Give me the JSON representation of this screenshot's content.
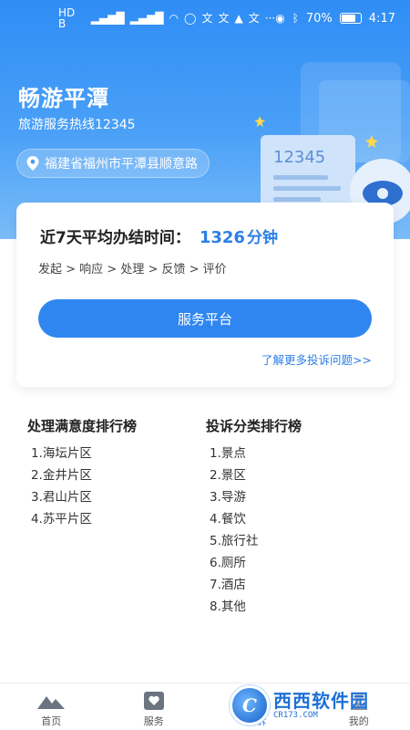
{
  "status_bar": {
    "left_tags": [
      "HD B",
      "HD B"
    ],
    "signal": "4G",
    "battery_percent": "70%",
    "time": "4:17"
  },
  "header": {
    "title": "畅游平潭",
    "subtitle": "旅游服务热线12345",
    "address": "福建省福州市平潭县顺意路",
    "deco_number": "12345"
  },
  "card": {
    "avg_label": "近7天平均办结时间：",
    "avg_value": "1326",
    "avg_unit": "分钟",
    "flow": "发起 > 响应 > 处理 > 反馈 > 评价",
    "service_button": "服务平台",
    "more_link": "了解更多投诉问题>>"
  },
  "rankings": {
    "satisfaction": {
      "title": "处理满意度排行榜",
      "items": [
        "1.海坛片区",
        "2.金井片区",
        "3.君山片区",
        "4.苏平片区"
      ]
    },
    "category": {
      "title": "投诉分类排行榜",
      "items": [
        "1.景点",
        "2.景区",
        "3.导游",
        "4.餐饮",
        "5.旅行社",
        "6.厕所",
        "7.酒店",
        "8.其他"
      ]
    }
  },
  "tabbar": {
    "tabs": [
      {
        "label": "首页",
        "icon": "mountain-icon"
      },
      {
        "label": "服务",
        "icon": "heart-shield-icon"
      },
      {
        "label": "投诉",
        "icon": "complaint-icon"
      },
      {
        "label": "我的",
        "icon": "profile-icon"
      }
    ],
    "active_index": 2
  },
  "watermark": {
    "logo_letter": "C",
    "name": "西西软件园",
    "url": "CR173.COM"
  },
  "colors": {
    "primary": "#2f86f0",
    "link": "#2d7fe6"
  }
}
